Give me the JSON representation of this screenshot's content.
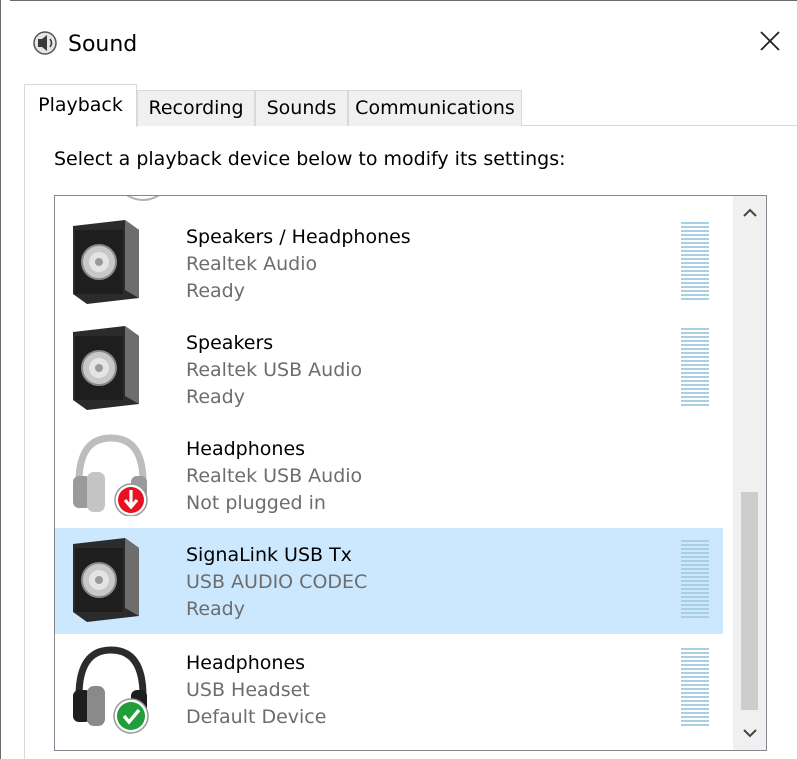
{
  "window": {
    "title": "Sound",
    "title_icon": "speaker-icon",
    "close_glyph": "✕"
  },
  "tabs": [
    {
      "label": "Playback",
      "active": true
    },
    {
      "label": "Recording",
      "active": false
    },
    {
      "label": "Sounds",
      "active": false
    },
    {
      "label": "Communications",
      "active": false
    }
  ],
  "instruction": "Select a playback device below to modify its settings:",
  "devices": [
    {
      "name": "Speakers / Headphones",
      "driver": "Realtek Audio",
      "status": "Ready",
      "icon": "speaker-icon",
      "selected": false
    },
    {
      "name": "Speakers",
      "driver": "Realtek USB Audio",
      "status": "Ready",
      "icon": "speaker-icon",
      "selected": false
    },
    {
      "name": "Headphones",
      "driver": "Realtek USB Audio",
      "status": "Not plugged in",
      "icon": "headphones-unplugged-icon",
      "selected": false
    },
    {
      "name": "SignaLink USB Tx",
      "driver": "USB AUDIO  CODEC",
      "status": "Ready",
      "icon": "speaker-icon",
      "selected": true
    },
    {
      "name": "Headphones",
      "driver": "USB Headset",
      "status": "Default Device",
      "icon": "headphones-default-icon",
      "selected": false
    }
  ],
  "scrollbar": {
    "up_glyph": "⌃",
    "down_glyph": "⌄"
  },
  "colors": {
    "selection": "#cce8ff",
    "meter": "#a9cfe3",
    "status_text": "#6d6d6d",
    "default_badge": "#1f9e3a",
    "unplugged_badge": "#e81123"
  }
}
